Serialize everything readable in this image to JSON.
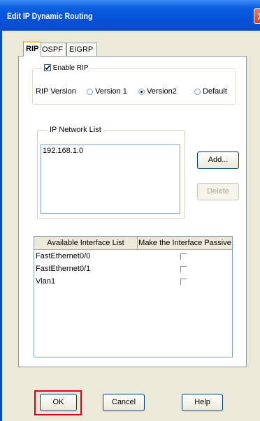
{
  "window": {
    "title": "Edit IP Dynamic Routing",
    "close_glyph": "X"
  },
  "tabs": [
    "RIP",
    "OSPF",
    "EIGRP"
  ],
  "enable_rip": {
    "label": "Enable RIP",
    "checked": true
  },
  "rip_version": {
    "label": "RIP Version",
    "options": [
      "Version 1",
      "Version2",
      "Default"
    ],
    "selected": "Version2"
  },
  "network_list": {
    "label": "IP Network List",
    "items": [
      "192.168.1.0"
    ]
  },
  "buttons": {
    "add": "Add...",
    "delete": "Delete",
    "ok": "OK",
    "cancel": "Cancel",
    "help": "Help"
  },
  "interface_table": {
    "columns": [
      "Available Interface List",
      "Make the Interface Passive"
    ],
    "rows": [
      {
        "name": "FastEthernet0/0",
        "passive": false
      },
      {
        "name": "FastEthernet0/1",
        "passive": false
      },
      {
        "name": "Vlan1",
        "passive": false
      }
    ]
  },
  "colors": {
    "title_bar": "#0652d8",
    "dialog_bg": "#ece9d8",
    "ok_highlight": "#e0001b"
  }
}
